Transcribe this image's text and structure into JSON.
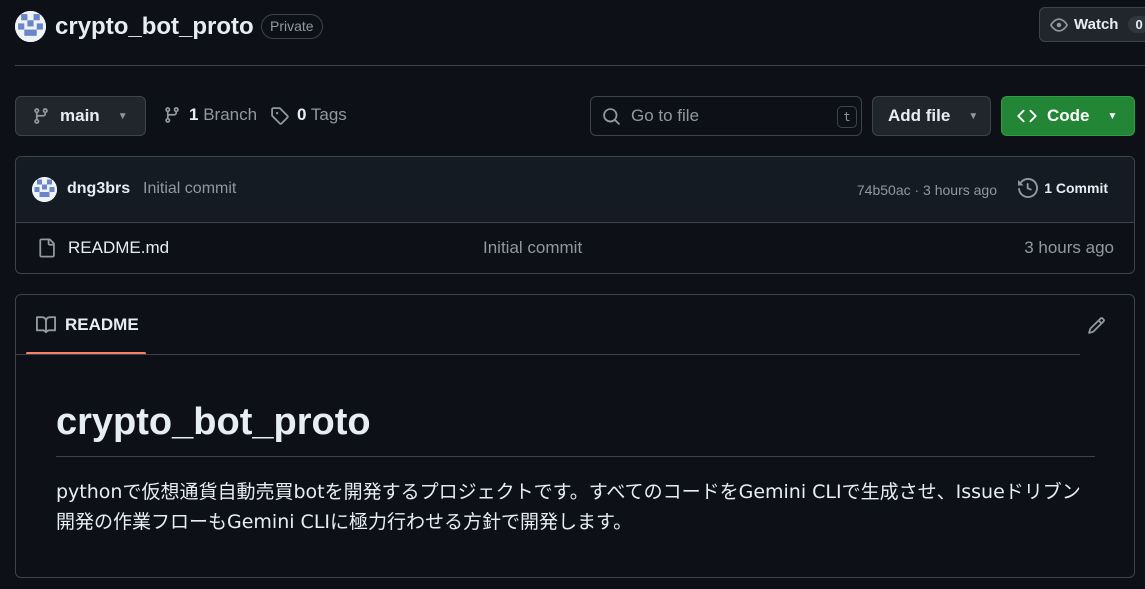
{
  "repo": {
    "name": "crypto_bot_proto",
    "visibility": "Private",
    "watch_label": "Watch",
    "watch_count": "0"
  },
  "toolbar": {
    "branch": "main",
    "branch_count": "1",
    "branch_label": "Branch",
    "tag_count": "0",
    "tag_label": "Tags",
    "search_placeholder": "Go to file",
    "search_shortcut": "t",
    "add_file_label": "Add file",
    "code_label": "Code"
  },
  "latest_commit": {
    "author": "dng3brs",
    "message": "Initial commit",
    "sha_time": "74b50ac · 3 hours ago",
    "commit_count_label": "1 Commit"
  },
  "files": [
    {
      "name": "README.md",
      "message": "Initial commit",
      "time": "3 hours ago"
    }
  ],
  "readme": {
    "tab_label": "README",
    "heading": "crypto_bot_proto",
    "body": "pythonで仮想通貨自動売買botを開発するプロジェクトです。すべてのコードをGemini CLIで生成させ、Issueドリブン開発の作業フローもGemini CLIに極力行わせる方針で開発します。"
  },
  "colors": {
    "background": "#0d1117",
    "border": "#3d444d",
    "code_button": "#238636",
    "tab_underline": "#f78166"
  },
  "icons": {
    "avatar": "identicon-avatar",
    "watch": "eye-icon",
    "branch": "git-branch-icon",
    "tag": "tag-icon",
    "search": "search-icon",
    "code": "code-icon",
    "history": "history-icon",
    "file": "file-icon",
    "book": "book-icon",
    "edit": "pencil-icon"
  }
}
